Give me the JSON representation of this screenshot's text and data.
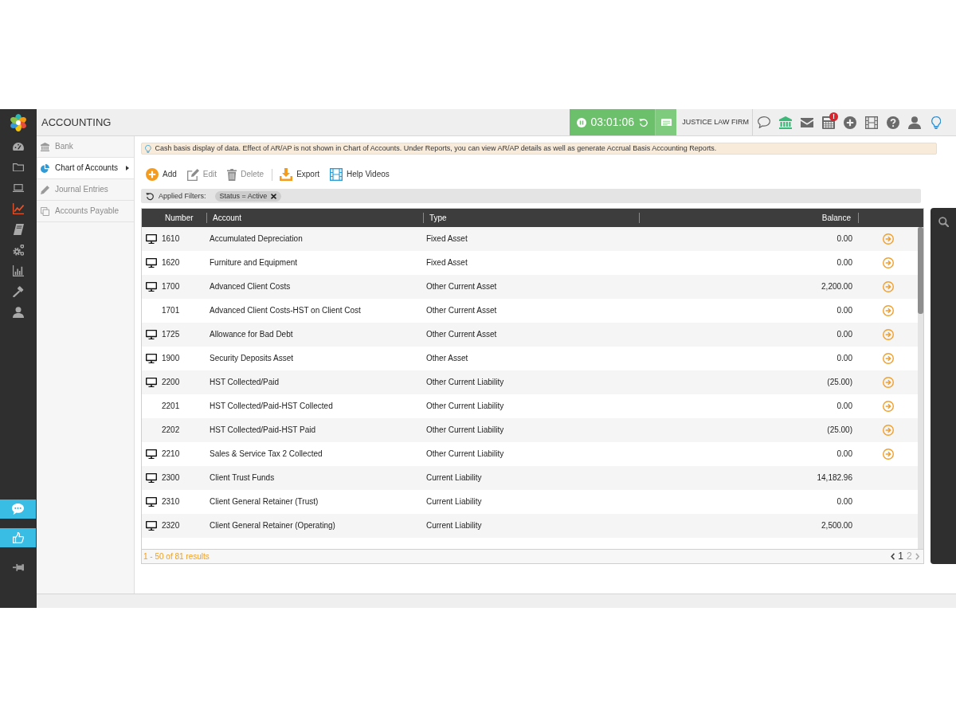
{
  "app_rail": {
    "items": [
      {
        "kind": "gauge",
        "selected": false
      },
      {
        "kind": "folder",
        "selected": false
      },
      {
        "kind": "laptop",
        "selected": false
      },
      {
        "kind": "chart",
        "selected": true
      },
      {
        "kind": "book",
        "selected": false
      },
      {
        "kind": "gears",
        "selected": false
      },
      {
        "kind": "bars",
        "selected": false
      },
      {
        "kind": "gavel",
        "selected": false
      },
      {
        "kind": "user",
        "selected": false
      }
    ],
    "bottom_buttons": [
      {
        "kind": "chat"
      },
      {
        "kind": "like"
      },
      {
        "kind": "pin"
      }
    ]
  },
  "header": {
    "title": "ACCOUNTING",
    "timer": {
      "time": "03:01:06",
      "running": true
    },
    "firm": "JUSTICE LAW FIRM",
    "icons": [
      {
        "kind": "chat"
      },
      {
        "kind": "bank"
      },
      {
        "kind": "mail"
      },
      {
        "kind": "calculator",
        "badge": "!"
      },
      {
        "kind": "plus"
      },
      {
        "kind": "film"
      },
      {
        "kind": "help"
      },
      {
        "kind": "user"
      },
      {
        "kind": "bulb"
      }
    ]
  },
  "subnav": [
    {
      "label": "Bank",
      "kind": "bank",
      "selected": false
    },
    {
      "label": "Chart of Accounts",
      "kind": "pie",
      "selected": true
    },
    {
      "label": "Journal Entries",
      "kind": "pencil",
      "selected": false
    },
    {
      "label": "Accounts Payable",
      "kind": "copy",
      "selected": false
    }
  ],
  "notice": {
    "text": "Cash basis display of data. Effect of AR/AP is not shown in Chart of Accounts. Under Reports, you can view AR/AP details as well as generate Accrual Basis Accounting Reports."
  },
  "toolbar": [
    {
      "kind": "add",
      "label": "Add",
      "disabled": false
    },
    {
      "kind": "edit",
      "label": "Edit",
      "disabled": true
    },
    {
      "kind": "delete",
      "label": "Delete",
      "disabled": true
    },
    {
      "kind": "divider"
    },
    {
      "kind": "export",
      "label": "Export",
      "disabled": false
    },
    {
      "kind": "video",
      "label": "Help Videos",
      "disabled": false
    }
  ],
  "filters": {
    "label": "Applied Filters:",
    "chips": [
      {
        "label": "Status = Active"
      }
    ]
  },
  "table": {
    "columns": [
      "Number",
      "Account",
      "Type",
      "Balance"
    ],
    "rows": [
      {
        "number": "1610",
        "account": "Accumulated Depreciation",
        "type": "Fixed Asset",
        "balance": "0.00",
        "screen_icon": true,
        "open_button": true
      },
      {
        "number": "1620",
        "account": "Furniture and Equipment",
        "type": "Fixed Asset",
        "balance": "0.00",
        "screen_icon": true,
        "open_button": true
      },
      {
        "number": "1700",
        "account": "Advanced Client Costs",
        "type": "Other Current Asset",
        "balance": "2,200.00",
        "screen_icon": true,
        "open_button": true
      },
      {
        "number": "1701",
        "account": "Advanced Client Costs-HST on Client Cost",
        "type": "Other Current Asset",
        "balance": "0.00",
        "screen_icon": false,
        "open_button": true
      },
      {
        "number": "1725",
        "account": "Allowance for Bad Debt",
        "type": "Other Current Asset",
        "balance": "0.00",
        "screen_icon": true,
        "open_button": true
      },
      {
        "number": "1900",
        "account": "Security Deposits Asset",
        "type": "Other Asset",
        "balance": "0.00",
        "screen_icon": true,
        "open_button": true
      },
      {
        "number": "2200",
        "account": "HST Collected/Paid",
        "type": "Other Current Liability",
        "balance": "(25.00)",
        "screen_icon": true,
        "open_button": true
      },
      {
        "number": "2201",
        "account": "HST Collected/Paid-HST Collected",
        "type": "Other Current Liability",
        "balance": "0.00",
        "screen_icon": false,
        "open_button": true
      },
      {
        "number": "2202",
        "account": "HST Collected/Paid-HST Paid",
        "type": "Other Current Liability",
        "balance": "(25.00)",
        "screen_icon": false,
        "open_button": true
      },
      {
        "number": "2210",
        "account": "Sales & Service Tax 2 Collected",
        "type": "Other Current Liability",
        "balance": "0.00",
        "screen_icon": true,
        "open_button": true
      },
      {
        "number": "2300",
        "account": "Client Trust Funds",
        "type": "Current Liability",
        "balance": "14,182.96",
        "screen_icon": true,
        "open_button": false
      },
      {
        "number": "2310",
        "account": "Client General Retainer (Trust)",
        "type": "Current Liability",
        "balance": "0.00",
        "screen_icon": true,
        "open_button": false
      },
      {
        "number": "2320",
        "account": "Client General Retainer (Operating)",
        "type": "Current Liability",
        "balance": "2,500.00",
        "screen_icon": true,
        "open_button": false
      }
    ],
    "footer": {
      "results": "1 - 50 of 81 results",
      "pages": [
        {
          "label": "1",
          "selected": true
        },
        {
          "label": "2",
          "selected": false
        }
      ]
    }
  }
}
